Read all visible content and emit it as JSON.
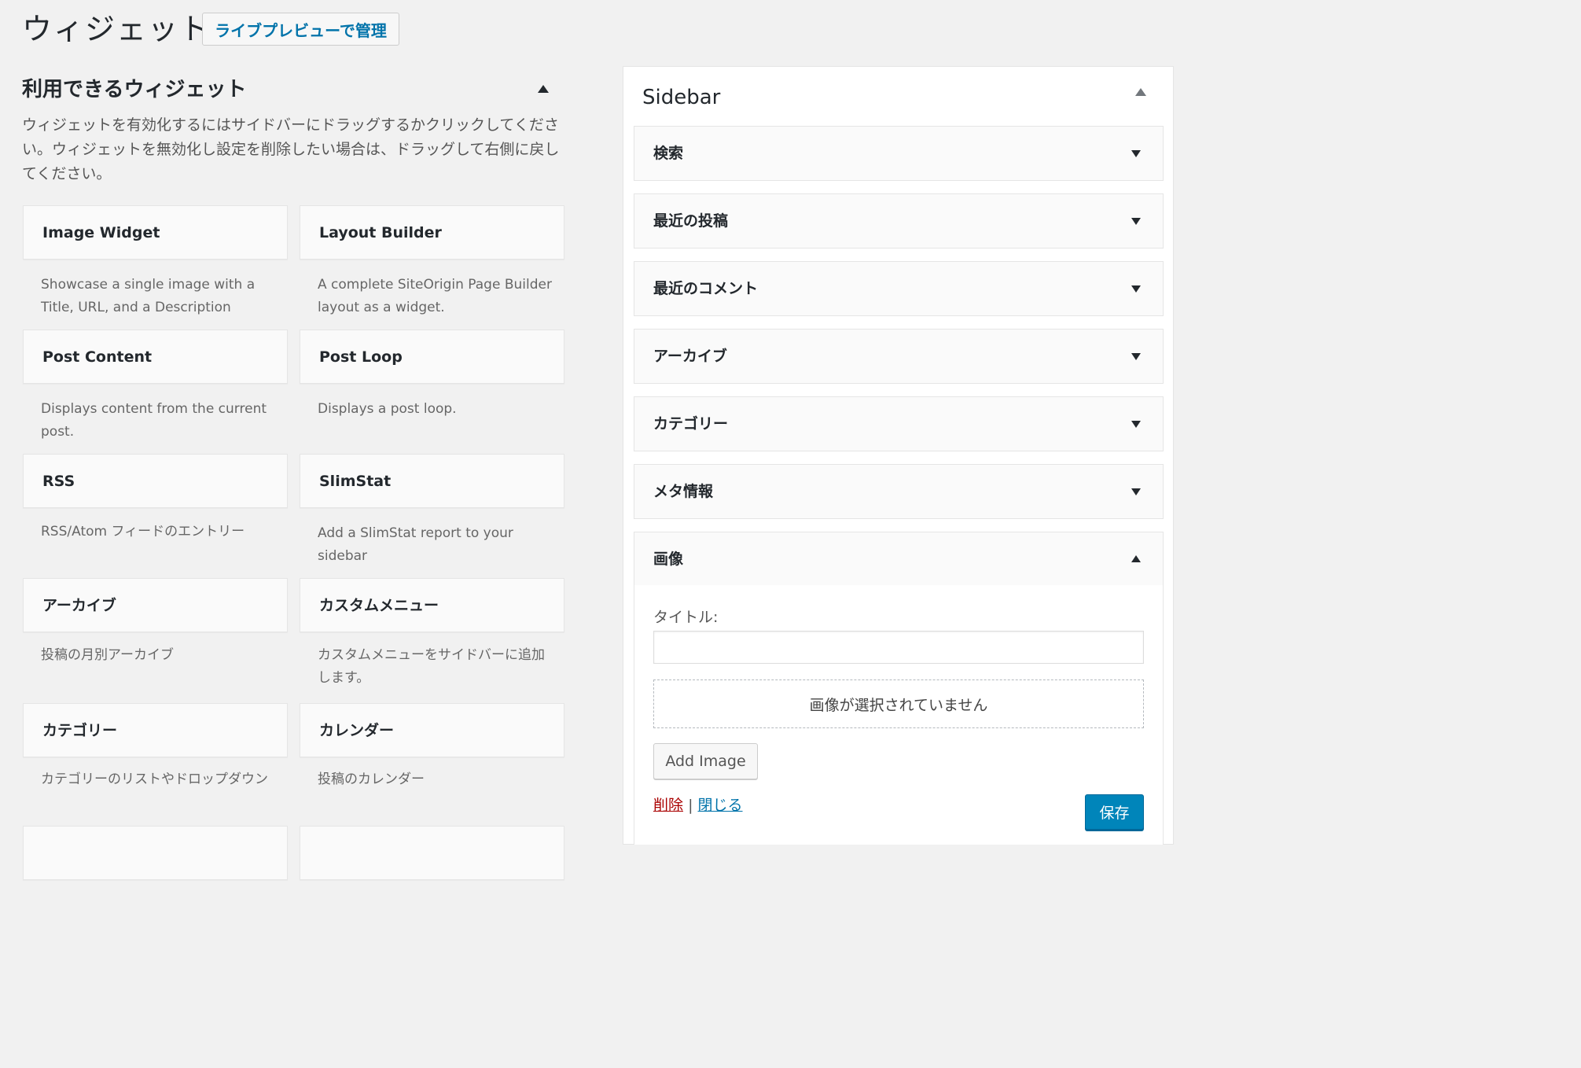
{
  "header": {
    "title": "ウィジェット",
    "live_preview_label": "ライブプレビューで管理"
  },
  "available": {
    "title": "利用できるウィジェット",
    "description": "ウィジェットを有効化するにはサイドバーにドラッグするかクリックしてください。ウィジェットを無効化し設定を削除したい場合は、ドラッグして右側に戻してください。",
    "widgets": [
      {
        "title": "Image Widget",
        "desc": "Showcase a single image with a Title, URL, and a Description"
      },
      {
        "title": "Layout Builder",
        "desc": "A complete SiteOrigin Page Builder layout as a widget."
      },
      {
        "title": "Post Content",
        "desc": "Displays content from the current post."
      },
      {
        "title": "Post Loop",
        "desc": "Displays a post loop."
      },
      {
        "title": "RSS",
        "desc": "RSS/Atom フィードのエントリー"
      },
      {
        "title": "SlimStat",
        "desc": "Add a SlimStat report to your sidebar"
      },
      {
        "title": "アーカイブ",
        "desc": "投稿の月別アーカイブ"
      },
      {
        "title": "カスタムメニュー",
        "desc": "カスタムメニューをサイドバーに追加します。"
      },
      {
        "title": "カテゴリー",
        "desc": "カテゴリーのリストやドロップダウン"
      },
      {
        "title": "カレンダー",
        "desc": "投稿のカレンダー"
      }
    ]
  },
  "sidebar": {
    "title": "Sidebar",
    "widgets": [
      "検索",
      "最近の投稿",
      "最近のコメント",
      "アーカイブ",
      "カテゴリー",
      "メタ情報",
      "画像"
    ],
    "image_form": {
      "title_label": "タイトル:",
      "title_value": "",
      "no_image_text": "画像が選択されていません",
      "add_image_label": "Add Image",
      "delete_label": "削除",
      "separator": "|",
      "close_label": "閉じる",
      "save_label": "保存"
    }
  },
  "colors": {
    "background": "#f1f1f1",
    "link": "#0073aa",
    "delete": "#aa0000",
    "primary_button": "#0085ba"
  }
}
